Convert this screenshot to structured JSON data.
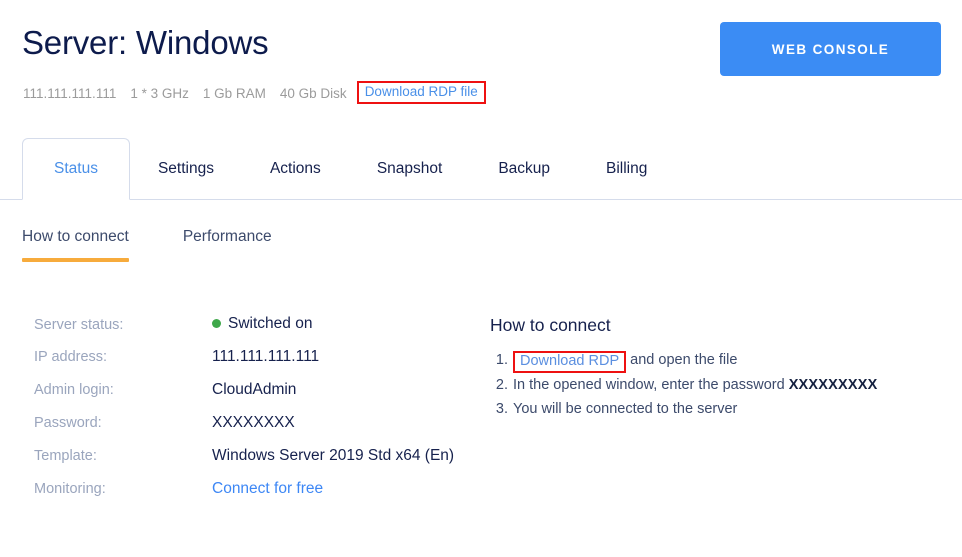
{
  "header": {
    "title": "Server: Windows",
    "specs": [
      "111.111.111.111",
      "1 * 3 GHz",
      "1 Gb RAM",
      "40 Gb Disk"
    ],
    "rdp_file_link": "Download RDP file",
    "web_console_button": "WEB CONSOLE",
    "accent_blue": "#3b8cf4",
    "highlight_red": "#ee1111"
  },
  "tabs": [
    {
      "label": "Status",
      "active": true
    },
    {
      "label": "Settings",
      "active": false
    },
    {
      "label": "Actions",
      "active": false
    },
    {
      "label": "Snapshot",
      "active": false
    },
    {
      "label": "Backup",
      "active": false
    },
    {
      "label": "Billing",
      "active": false
    }
  ],
  "subtabs": [
    {
      "label": "How to connect",
      "active": true
    },
    {
      "label": "Performance",
      "active": false
    }
  ],
  "details": [
    {
      "label": "Server status:",
      "value": "Switched on",
      "kind": "status",
      "dot_color": "#3fa84a"
    },
    {
      "label": "IP address:",
      "value": "111.111.111.111",
      "kind": "text"
    },
    {
      "label": "Admin login:",
      "value": "CloudAdmin",
      "kind": "text"
    },
    {
      "label": "Password:",
      "value": "XXXXXXXX",
      "kind": "text"
    },
    {
      "label": "Template:",
      "value": "Windows Server 2019 Std x64 (En)",
      "kind": "text"
    },
    {
      "label": "Monitoring:",
      "value": "Connect for free",
      "kind": "link"
    }
  ],
  "howto": {
    "title": "How to connect",
    "steps": [
      {
        "num": "1.",
        "link": "Download RDP",
        "after": " and open the file"
      },
      {
        "num": "2.",
        "before": "In the opened window, enter the password ",
        "bold": "XXXXXXXXX"
      },
      {
        "num": "3.",
        "text": "You will be connected to the server"
      }
    ]
  }
}
